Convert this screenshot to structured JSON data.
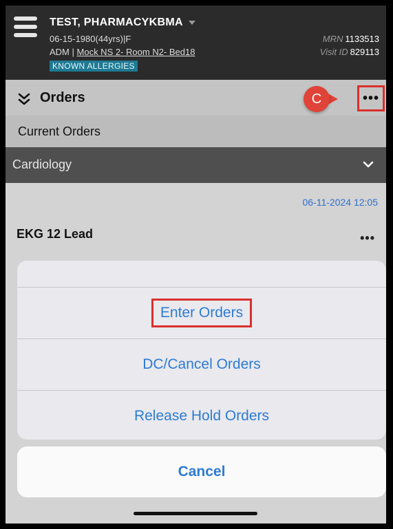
{
  "patient": {
    "name": "TEST, PHARMACYKBMA",
    "dob_line": "06-15-1980(44yrs)|F",
    "adm_prefix": "ADM |",
    "location": "Mock NS 2- Room N2- Bed18",
    "allergy_badge": "KNOWN ALLERGIES",
    "mrn_label": "MRN",
    "mrn_value": "1133513",
    "visit_label": "Visit ID",
    "visit_value": "829113"
  },
  "orders_bar": {
    "title": "Orders",
    "callout_letter": "C",
    "more_label": "•••"
  },
  "section": {
    "current_orders": "Current Orders",
    "category": "Cardiology"
  },
  "order_item": {
    "date": "06-11-2024 12:05",
    "name": "EKG 12 Lead",
    "more_label": "•••"
  },
  "action_sheet": {
    "items": [
      {
        "label": "Enter Orders"
      },
      {
        "label": "DC/Cancel Orders"
      },
      {
        "label": "Release Hold Orders"
      }
    ],
    "cancel_label": "Cancel"
  },
  "colors": {
    "header_bg": "#2b2b2b",
    "allergy_badge": "#1f7a93",
    "link_blue": "#2e7bd1",
    "annotation_red": "#e04337"
  },
  "icons": [
    "hamburger-menu-icon",
    "caret-down-icon",
    "double-chevron-icon",
    "chevron-down-icon",
    "more-options-icon"
  ]
}
